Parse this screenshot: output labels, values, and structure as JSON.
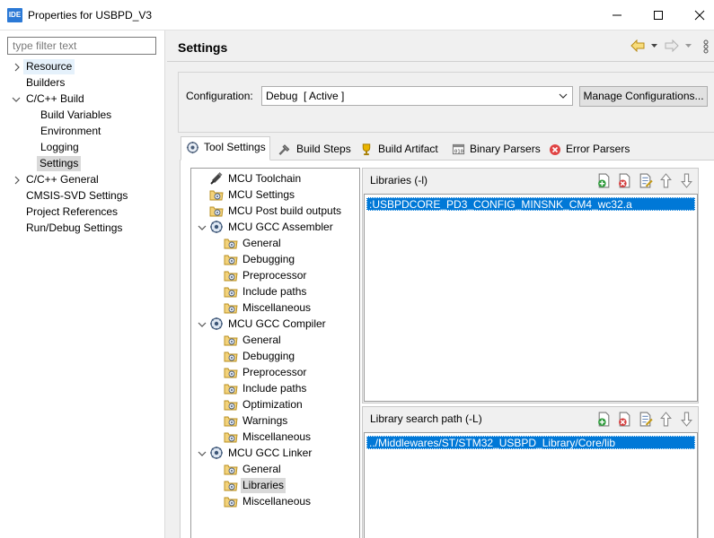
{
  "window": {
    "title": "Properties for USBPD_V3",
    "app_icon_text": "IDE"
  },
  "filter": {
    "placeholder": "type filter text"
  },
  "nav": [
    {
      "label": "Resource",
      "state": "hovered",
      "expandable": true,
      "expanded": false
    },
    {
      "label": "Builders"
    },
    {
      "label": "C/C++ Build",
      "expandable": true,
      "expanded": true
    },
    {
      "label": "Build Variables"
    },
    {
      "label": "Environment"
    },
    {
      "label": "Logging"
    },
    {
      "label": "Settings",
      "state": "selected"
    },
    {
      "label": "C/C++ General",
      "expandable": true,
      "expanded": false
    },
    {
      "label": "CMSIS-SVD Settings"
    },
    {
      "label": "Project References"
    },
    {
      "label": "Run/Debug Settings"
    }
  ],
  "header": {
    "title": "Settings"
  },
  "configuration": {
    "label": "Configuration:",
    "value": "Debug  [ Active ]",
    "manage_label": "Manage Configurations..."
  },
  "tabs": [
    {
      "label": "Tool Settings",
      "icon": "tool-settings-icon",
      "active": true
    },
    {
      "label": "Build Steps",
      "icon": "build-steps-icon"
    },
    {
      "label": "Build Artifact",
      "icon": "trophy-icon"
    },
    {
      "label": "Binary Parsers",
      "icon": "binary-parsers-icon"
    },
    {
      "label": "Error Parsers",
      "icon": "error-parsers-icon"
    }
  ],
  "tool_tree": [
    {
      "label": "MCU Toolchain",
      "icon": "toolchain-icon"
    },
    {
      "label": "MCU Settings",
      "icon": "folder-settings-icon"
    },
    {
      "label": "MCU Post build outputs",
      "icon": "folder-settings-icon"
    },
    {
      "label": "MCU GCC Assembler",
      "icon": "tool-gear-icon",
      "expanded": true
    },
    {
      "label": "General",
      "icon": "folder-settings-icon"
    },
    {
      "label": "Debugging",
      "icon": "folder-settings-icon"
    },
    {
      "label": "Preprocessor",
      "icon": "folder-settings-icon"
    },
    {
      "label": "Include paths",
      "icon": "folder-settings-icon"
    },
    {
      "label": "Miscellaneous",
      "icon": "folder-settings-icon"
    },
    {
      "label": "MCU GCC Compiler",
      "icon": "tool-gear-icon",
      "expanded": true
    },
    {
      "label": "General",
      "icon": "folder-settings-icon"
    },
    {
      "label": "Debugging",
      "icon": "folder-settings-icon"
    },
    {
      "label": "Preprocessor",
      "icon": "folder-settings-icon"
    },
    {
      "label": "Include paths",
      "icon": "folder-settings-icon"
    },
    {
      "label": "Optimization",
      "icon": "folder-settings-icon"
    },
    {
      "label": "Warnings",
      "icon": "folder-settings-icon"
    },
    {
      "label": "Miscellaneous",
      "icon": "folder-settings-icon"
    },
    {
      "label": "MCU GCC Linker",
      "icon": "tool-gear-icon",
      "expanded": true
    },
    {
      "label": "General",
      "icon": "folder-settings-icon"
    },
    {
      "label": "Libraries",
      "icon": "folder-settings-icon",
      "selected": true
    },
    {
      "label": "Miscellaneous",
      "icon": "folder-settings-icon"
    }
  ],
  "libraries": {
    "title": "Libraries (-l)",
    "items": [
      ":USBPDCORE_PD3_CONFIG_MINSNK_CM4_wc32.a"
    ]
  },
  "library_paths": {
    "title": "Library search path (-L)",
    "items": [
      "../Middlewares/ST/STM32_USBPD_Library/Core/lib"
    ]
  },
  "list_toolbar": [
    "add-icon",
    "delete-icon",
    "edit-icon",
    "move-up-icon",
    "move-down-icon"
  ],
  "colors": {
    "selection": "#0078d7",
    "accent": "#2b79d6"
  }
}
